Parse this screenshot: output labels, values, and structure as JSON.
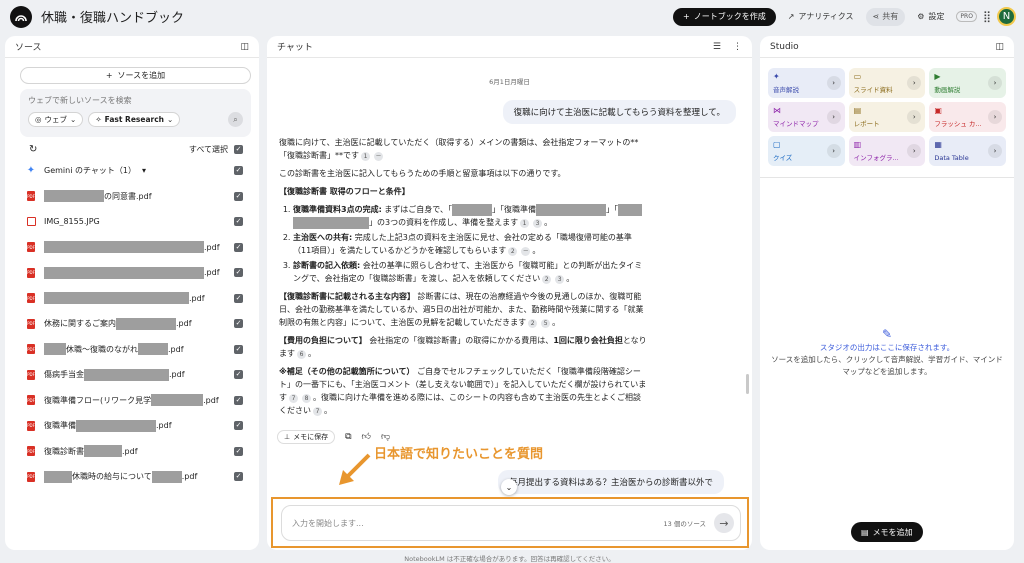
{
  "app": {
    "title": "休職・復職ハンドブック"
  },
  "topbar": {
    "create_notebook": "ノートブックを作成",
    "analytics": "アナリティクス",
    "share": "共有",
    "settings": "設定",
    "pro_badge": "PRO",
    "avatar_initial": "N"
  },
  "sources": {
    "header": "ソース",
    "add_source": "ソースを追加",
    "search_placeholder": "ウェブで新しいソースを検索",
    "chip_web": "ウェブ",
    "chip_research": "Fast Research",
    "select_all": "すべて選択",
    "items": [
      {
        "type": "gemini",
        "prefix": "Gemini のチャット（1）",
        "suffix": ""
      },
      {
        "type": "pdf",
        "prefix": "",
        "suffix": "の同意書.pdf"
      },
      {
        "type": "img",
        "prefix": "IMG_8155.JPG",
        "suffix": ""
      },
      {
        "type": "pdf",
        "prefix": "",
        "suffix": ".pdf"
      },
      {
        "type": "pdf",
        "prefix": "",
        "suffix": ".pdf"
      },
      {
        "type": "pdf",
        "prefix": "",
        "suffix": ".pdf"
      },
      {
        "type": "pdf",
        "prefix": "休務に関するご案内",
        "suffix": ".pdf"
      },
      {
        "type": "pdf",
        "prefix": "",
        "suffix": "休職〜復職のながれ"
      },
      {
        "type": "pdf",
        "prefix": "傷病手当金",
        "suffix": ".pdf"
      },
      {
        "type": "pdf",
        "prefix": "復職準備フロー(リワーク見学",
        "suffix": ".pdf"
      },
      {
        "type": "pdf",
        "prefix": "復職準備",
        "suffix": ".pdf"
      },
      {
        "type": "pdf",
        "prefix": "復職診断書",
        "suffix": ".pdf"
      },
      {
        "type": "pdf",
        "prefix": "",
        "suffix": "休職時の給与について"
      }
    ],
    "item7_tail": ".pdf",
    "item12_tail": ".pdf"
  },
  "chat": {
    "header": "チャット",
    "date": "6月1日月曜日",
    "user_msg1": "復職に向けて主治医に記載してもらう資料を整理して。",
    "p1": "復職に向けて、主治医に記載していただく（取得する）メインの書類は、会社指定フォーマットの**「復職診断書」**です",
    "p2": "この診断書を主治医に記入してもらうための手順と留意事項は以下の通りです。",
    "h1": "【復職診断書 取得のフローと条件】",
    "li1_b": "復職準備資料3点の完成:",
    "li1": " まずはご自身で、「",
    "li1_m1": "」「復職準備",
    "li1_m2": "」「",
    "li1_end": "」の3つの資料を作成し、準備を整えます",
    "li2_b": "主治医への共有:",
    "li2": " 完成した上記3点の資料を主治医に見せ、会社の定める「職場復帰可能の基準（11項目）」を満たしているかどうかを確認してもらいます",
    "li3_b": "診断書の記入依頼:",
    "li3": " 会社の基準に照らし合わせて、主治医から「復職可能」との判断が出たタイミングで、会社指定の「復職診断書」を渡し、記入を依頼してください",
    "h2": "【復職診断書に記載される主な内容】",
    "p3": " 診断書には、現在の治療経過や今後の見通しのほか、復職可能日、会社の勤務基準を満たしているか、週5日の出社が可能か、また、勤務時間や残業に関する「就業制限の有無と内容」について、主治医の見解を記載していただきます",
    "h3": "【費用の負担について】",
    "p4a": " 会社指定の「復職診断書」の取得にかかる費用は、",
    "p4b": "1回に限り会社負担",
    "p4c": "となります",
    "h4": "※補足（その他の記載箇所について）",
    "p5": " ご自身でセルフチェックしていただく「復職準備段階確認シート」の一番下にも、「主治医コメント（差し支えない範囲で）」を記入していただく欄が設けられています",
    "p5b": "。復職に向けた準備を進める際には、このシートの内容も含めて主治医の先生とよくご相談ください",
    "save_memo": "メモに保存",
    "user_msg2": "毎月提出する資料はある？主治医からの診断書以外で",
    "input_placeholder": "入力を開始します...",
    "source_count": "13 個のソース",
    "footer": "NotebookLM は不正確な場合があります。回答は再確認してください。",
    "annotation": "日本語で知りたいことを質問",
    "cites": {
      "c1": "1",
      "dash": "－",
      "c2": "2",
      "c3": "3",
      "c5": "5",
      "c6": "6",
      "c7": "7",
      "c8": "8"
    }
  },
  "studio": {
    "header": "Studio",
    "tiles": [
      {
        "label": "音声解説",
        "icon": "✦",
        "bg": "#e8ecf7",
        "fg": "#3949ab"
      },
      {
        "label": "スライド資料",
        "icon": "▭",
        "bg": "#f6f1e3",
        "fg": "#8d6e1f"
      },
      {
        "label": "動画解説",
        "icon": "▶",
        "bg": "#e6f2e7",
        "fg": "#2e7d32"
      },
      {
        "label": "マインドマップ",
        "icon": "⋈",
        "bg": "#f1e8f4",
        "fg": "#8e24aa"
      },
      {
        "label": "レポート",
        "icon": "▤",
        "bg": "#f6f1e3",
        "fg": "#8d6e1f"
      },
      {
        "label": "フラッシュ カ...",
        "icon": "▣",
        "bg": "#f9e9eb",
        "fg": "#c62828"
      },
      {
        "label": "クイズ",
        "icon": "▢",
        "bg": "#e5eef7",
        "fg": "#1565c0"
      },
      {
        "label": "インフォグラ...",
        "icon": "▥",
        "bg": "#f1e8f4",
        "fg": "#8e24aa"
      },
      {
        "label": "Data Table",
        "icon": "▦",
        "bg": "#e8ecf7",
        "fg": "#283593"
      }
    ],
    "empty_title": "スタジオの出力はここに保存されます。",
    "empty_desc1": "ソースを追加したら、クリックして音声解説、学習ガイド、マインド",
    "empty_desc2": "マップなどを追加します。",
    "add_memo": "メモを追加"
  },
  "colors": {
    "accent_orange": "#e8962e",
    "pdf_red": "#d93025"
  }
}
